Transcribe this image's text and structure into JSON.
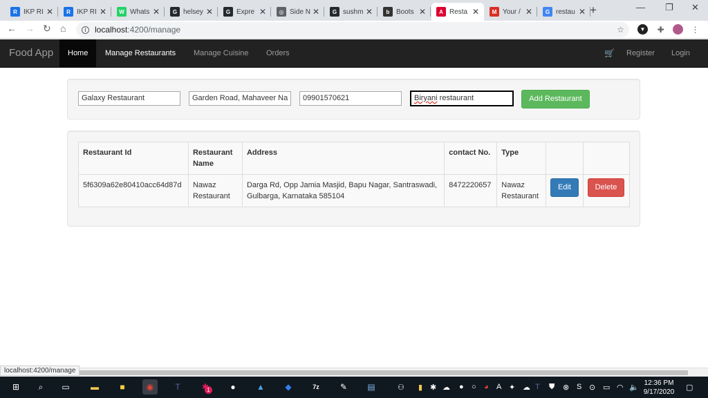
{
  "browser": {
    "tabs": [
      {
        "label": "IKP RI",
        "icon": "ikp-icon",
        "color": "#1a73e8",
        "glyph": "R"
      },
      {
        "label": "IKP RI",
        "icon": "ikp-icon",
        "color": "#1a73e8",
        "glyph": "R"
      },
      {
        "label": "Whats",
        "icon": "whatsapp-icon",
        "color": "#25d366",
        "glyph": "W"
      },
      {
        "label": "helsey",
        "icon": "github-icon",
        "color": "#24292e",
        "glyph": "G"
      },
      {
        "label": "Expre",
        "icon": "github-icon",
        "color": "#24292e",
        "glyph": "G"
      },
      {
        "label": "Side N",
        "icon": "globe-icon",
        "color": "#5f6368",
        "glyph": "◎"
      },
      {
        "label": "sushm",
        "icon": "github-icon",
        "color": "#24292e",
        "glyph": "G"
      },
      {
        "label": "Boots",
        "icon": "bootstrap-icon",
        "color": "#333333",
        "glyph": "b"
      },
      {
        "label": "Resta",
        "icon": "angular-icon",
        "color": "#dd0031",
        "glyph": "A",
        "active": true
      },
      {
        "label": "Your /",
        "icon": "gmail-icon",
        "color": "#d93025",
        "glyph": "M"
      },
      {
        "label": "restau",
        "icon": "google-icon",
        "color": "#4285f4",
        "glyph": "G"
      }
    ],
    "url_host": "localhost",
    "url_path": ":4200/manage",
    "status_url": "localhost:4200/manage"
  },
  "nav": {
    "brand": "Food App",
    "items": [
      "Home",
      "Manage Restaurants",
      "Manage Cuisine",
      "Orders"
    ],
    "register": "Register",
    "login": "Login"
  },
  "form": {
    "name": "Galaxy Restaurant",
    "address": "Garden Road, Mahaveer Na",
    "contact": "09901570621",
    "type_misspelled": "Biryani",
    "type_rest": " restaurant",
    "add_button": "Add Restaurant"
  },
  "table": {
    "headers": [
      "Restaurant Id",
      "Restaurant Name",
      "Address",
      "contact No.",
      "Type",
      "",
      ""
    ],
    "rows": [
      {
        "id": "5f6309a62e80410acc64d87d",
        "name": "Nawaz Restaurant",
        "address": "Darga Rd, Opp Jamia Masjid, Bapu Nagar, Santraswadi, Gulbarga, Karnataka 585104",
        "contact": "8472220657",
        "type": "Nawaz Restaurant",
        "edit": "Edit",
        "delete": "Delete"
      }
    ]
  },
  "taskbar": {
    "time": "12:36 PM",
    "date": "9/17/2020",
    "teams_badge": "1",
    "sevenzip": "7z"
  },
  "colors": {
    "navbar": "#222222",
    "success": "#5cb85c",
    "primary": "#337ab7",
    "danger": "#d9534f"
  }
}
